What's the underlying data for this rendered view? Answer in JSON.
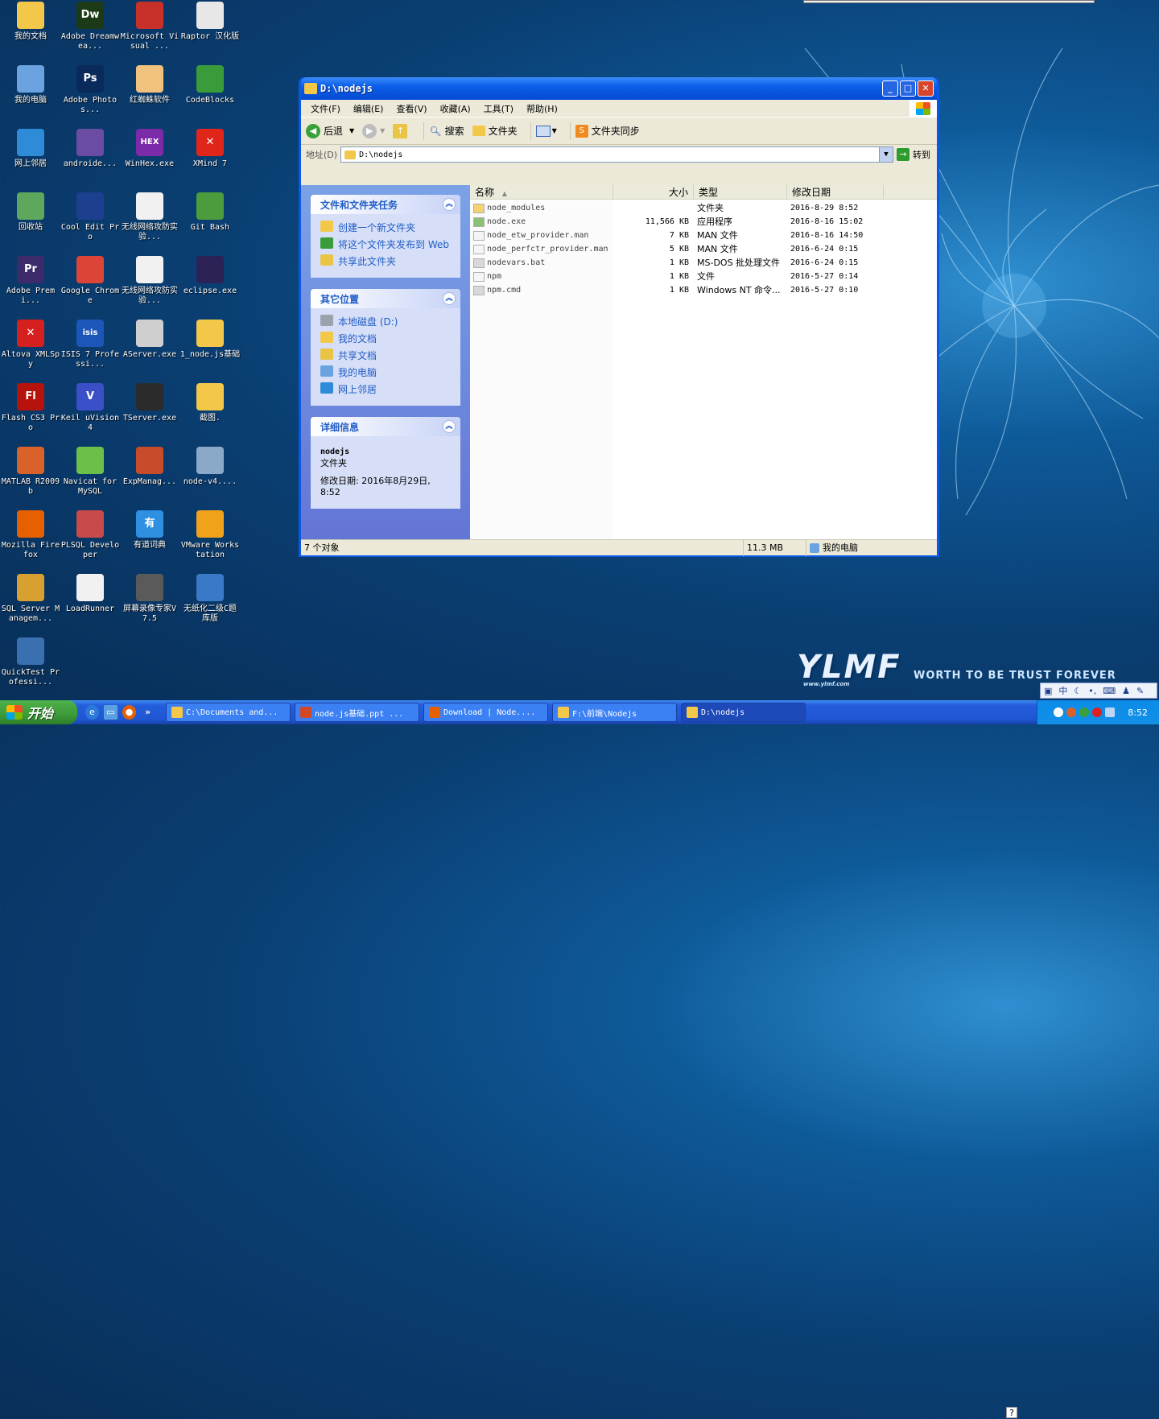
{
  "desktop_icons": [
    {
      "label": "我的文档",
      "icon": "documents-icon",
      "color": "#f3c84a"
    },
    {
      "label": "Adobe Dreamwea...",
      "icon": "dw-icon",
      "color": "#1c3a16",
      "glyph": "Dw"
    },
    {
      "label": "Microsoft Visual ...",
      "icon": "visual-studio-icon",
      "color": "#c8302a"
    },
    {
      "label": "Raptor 汉化版",
      "icon": "raptor-icon",
      "color": "#e7e7e7"
    },
    {
      "label": "我的电脑",
      "icon": "computer-icon",
      "color": "#6ba3e0"
    },
    {
      "label": "Adobe Photos...",
      "icon": "ps-icon",
      "color": "#0b2a5c",
      "glyph": "Ps"
    },
    {
      "label": "红蜘蛛软件",
      "icon": "red-spider-icon",
      "color": "#f1c27d"
    },
    {
      "label": "CodeBlocks",
      "icon": "codeblocks-icon",
      "color": "#3a9b3a"
    },
    {
      "label": "网上邻居",
      "icon": "network-icon",
      "color": "#2e8bd8"
    },
    {
      "label": "androide...",
      "icon": "eclipse-icon",
      "color": "#6a4ca3"
    },
    {
      "label": "WinHex.exe",
      "icon": "winhex-icon",
      "color": "#7b2aa8",
      "glyph": "HEX"
    },
    {
      "label": "XMind 7",
      "icon": "xmind-icon",
      "color": "#e0261b",
      "glyph": "✕"
    },
    {
      "label": "回收站",
      "icon": "recycle-bin-icon",
      "color": "#5ea85e"
    },
    {
      "label": "Cool Edit Pro",
      "icon": "cooledit-icon",
      "color": "#1d3f8f"
    },
    {
      "label": "无线网络攻防实验...",
      "icon": "document-icon",
      "color": "#f1f1f1"
    },
    {
      "label": "Git Bash",
      "icon": "git-icon",
      "color": "#4c9b3c"
    },
    {
      "label": "Adobe Premi...",
      "icon": "pr-icon",
      "color": "#3d2a6b",
      "glyph": "Pr"
    },
    {
      "label": "Google Chrome",
      "icon": "chrome-icon",
      "color": "#db4437"
    },
    {
      "label": "无线网络攻防实验...",
      "icon": "document-icon",
      "color": "#f1f1f1"
    },
    {
      "label": "eclipse.exe",
      "icon": "eclipse-icon",
      "color": "#2c2255"
    },
    {
      "label": "Altova XMLSpy",
      "icon": "xmlspy-icon",
      "color": "#d62020",
      "glyph": "✕"
    },
    {
      "label": "ISIS 7 Professi...",
      "icon": "isis-icon",
      "color": "#1b56b8",
      "glyph": "isis"
    },
    {
      "label": "AServer.exe",
      "icon": "server-icon",
      "color": "#cfcfcf"
    },
    {
      "label": "1_node.js基础",
      "icon": "folder-icon",
      "color": "#f3c84a"
    },
    {
      "label": "Flash CS3 Pro",
      "icon": "flash-icon",
      "color": "#b5130b",
      "glyph": "Fl"
    },
    {
      "label": "Keil uVision4",
      "icon": "keil-icon",
      "color": "#3b4fc9",
      "glyph": "V"
    },
    {
      "label": "TServer.exe",
      "icon": "tserver-icon",
      "color": "#2b2b2b"
    },
    {
      "label": "截图.",
      "icon": "folder-icon",
      "color": "#f3c84a"
    },
    {
      "label": "MATLAB R2009b",
      "icon": "matlab-icon",
      "color": "#d9622b"
    },
    {
      "label": "Navicat for MySQL",
      "icon": "navicat-icon",
      "color": "#6cc04a"
    },
    {
      "label": "ExpManag...",
      "icon": "expmanager-icon",
      "color": "#c84b2b"
    },
    {
      "label": "node-v4....",
      "icon": "installer-icon",
      "color": "#8aa8c8"
    },
    {
      "label": "Mozilla Firefox",
      "icon": "firefox-icon",
      "color": "#e66000"
    },
    {
      "label": "PLSQL Developer",
      "icon": "plsql-icon",
      "color": "#c84a4a"
    },
    {
      "label": "有道词典",
      "icon": "youdao-icon",
      "color": "#2f8fe0",
      "glyph": "有"
    },
    {
      "label": "VMware Workstation",
      "icon": "vmware-icon",
      "color": "#f0a21a"
    },
    {
      "label": "SQL Server Managem...",
      "icon": "sqlserver-icon",
      "color": "#d8a030"
    },
    {
      "label": "LoadRunner",
      "icon": "loadrunner-icon",
      "color": "#f1f1f1"
    },
    {
      "label": "屏幕录像专家V7.5",
      "icon": "recorder-icon",
      "color": "#5a5a5a"
    },
    {
      "label": "无纸化二级C题库版",
      "icon": "exam-icon",
      "color": "#3a78c8"
    },
    {
      "label": "QuickTest Professi...",
      "icon": "quicktest-icon",
      "color": "#3a6fb0"
    }
  ],
  "window": {
    "title": "D:\\nodejs",
    "menu": [
      "文件(F)",
      "编辑(E)",
      "查看(V)",
      "收藏(A)",
      "工具(T)",
      "帮助(H)"
    ],
    "toolbar": {
      "back": "后退",
      "search": "搜索",
      "folders": "文件夹",
      "sync": "文件夹同步"
    },
    "address_label": "地址(D)",
    "address_value": "D:\\nodejs",
    "go_label": "转到",
    "tasks_panel": {
      "title": "文件和文件夹任务",
      "items": [
        "创建一个新文件夹",
        "将这个文件夹发布到 Web",
        "共享此文件夹"
      ]
    },
    "places_panel": {
      "title": "其它位置",
      "items": [
        "本地磁盘 (D:)",
        "我的文档",
        "共享文档",
        "我的电脑",
        "网上邻居"
      ]
    },
    "details_panel": {
      "title": "详细信息",
      "name": "nodejs",
      "type": "文件夹",
      "modified": "修改日期: 2016年8月29日, 8:52"
    },
    "columns": {
      "name": "名称",
      "size": "大小",
      "type": "类型",
      "modified": "修改日期"
    },
    "files": [
      {
        "name": "node_modules",
        "size": "",
        "type": "文件夹",
        "modified": "2016-8-29 8:52",
        "icon": "folder-icon"
      },
      {
        "name": "node.exe",
        "size": "11,566 KB",
        "type": "应用程序",
        "modified": "2016-8-16 15:02",
        "icon": "node-exe-icon"
      },
      {
        "name": "node_etw_provider.man",
        "size": "7 KB",
        "type": "MAN 文件",
        "modified": "2016-8-16 14:50",
        "icon": "file-icon"
      },
      {
        "name": "node_perfctr_provider.man",
        "size": "5 KB",
        "type": "MAN 文件",
        "modified": "2016-6-24 0:15",
        "icon": "file-icon"
      },
      {
        "name": "nodevars.bat",
        "size": "1 KB",
        "type": "MS-DOS 批处理文件",
        "modified": "2016-6-24 0:15",
        "icon": "bat-icon"
      },
      {
        "name": "npm",
        "size": "1 KB",
        "type": "文件",
        "modified": "2016-5-27 0:14",
        "icon": "file-icon"
      },
      {
        "name": "npm.cmd",
        "size": "1 KB",
        "type": "Windows NT 命令...",
        "modified": "2016-5-27 0:10",
        "icon": "cmd-icon"
      }
    ],
    "status": {
      "count": "7 个对象",
      "size": "11.3 MB",
      "location": "我的电脑"
    }
  },
  "taskbar": {
    "start": "开始",
    "tasks": [
      {
        "label": "C:\\Documents and...",
        "icon": "folder-icon",
        "color": "#f3c84a"
      },
      {
        "label": "node.js基础.ppt ...",
        "icon": "ppt-icon",
        "color": "#d24726"
      },
      {
        "label": "Download | Node....",
        "icon": "firefox-icon",
        "color": "#e66000"
      },
      {
        "label": "F:\\前端\\Nodejs",
        "icon": "folder-icon",
        "color": "#f3c84a"
      },
      {
        "label": "D:\\nodejs",
        "icon": "folder-icon",
        "color": "#f3c84a"
      }
    ],
    "clock": "8:52"
  },
  "ime": {
    "lang": "中"
  },
  "branding": {
    "logo": "YLMF",
    "tagline": "WORTH TO BE TRUST FOREVER",
    "url": "www.ylmf.com"
  }
}
